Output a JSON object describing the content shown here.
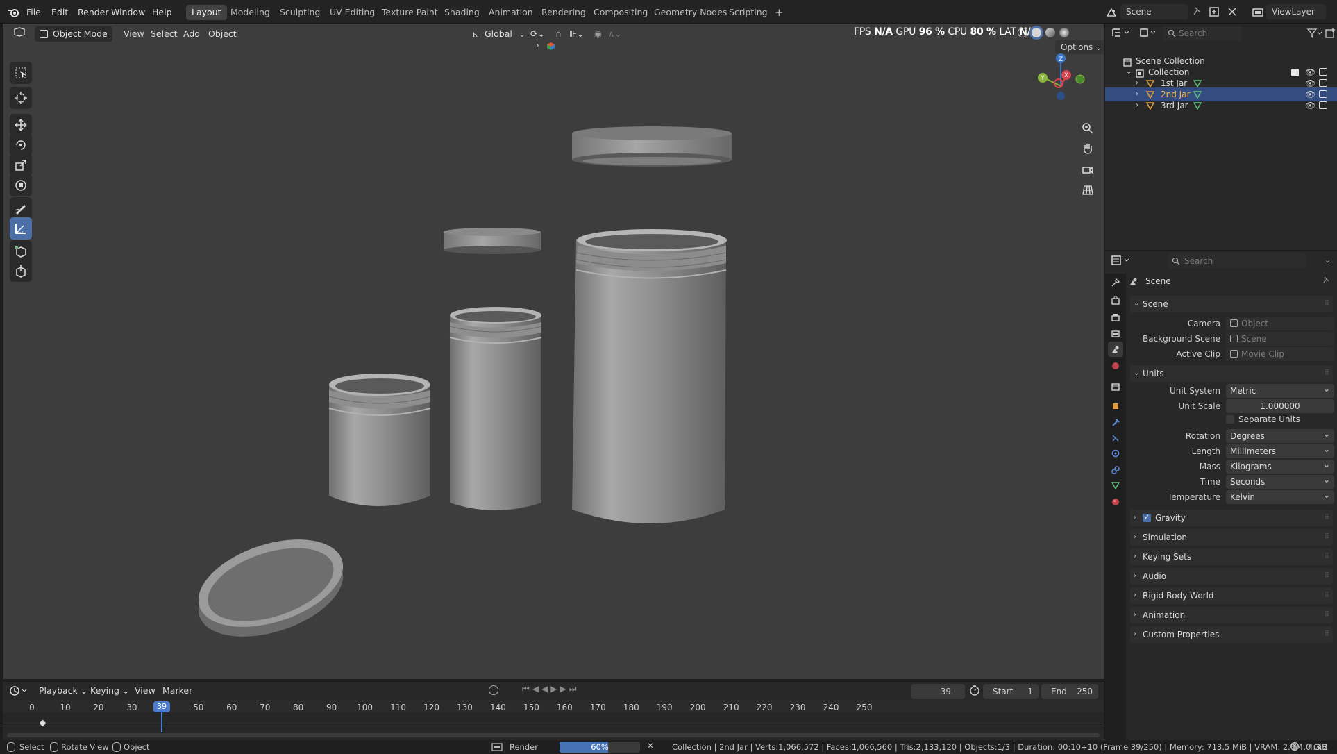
{
  "menu": {
    "file": "File",
    "edit": "Edit",
    "render": "Render",
    "window": "Window",
    "help": "Help"
  },
  "workspaces": [
    "Layout",
    "Modeling",
    "Sculpting",
    "UV Editing",
    "Texture Paint",
    "Shading",
    "Animation",
    "Rendering",
    "Compositing",
    "Geometry Nodes",
    "Scripting"
  ],
  "active_workspace": "Layout",
  "add_workspace": "+",
  "scene_field": "Scene",
  "viewlayer_field": "ViewLayer",
  "overlay_stats": {
    "fps_label": "FPS",
    "fps_value": "N/A",
    "gpu_label": "GPU",
    "gpu_value": "96 %",
    "cpu_label": "CPU",
    "cpu_value": "80 %",
    "lat_label": "LAT",
    "lat_value": "N/A"
  },
  "viewport": {
    "mode": "Object Mode",
    "menus": [
      "View",
      "Select",
      "Add",
      "Object"
    ],
    "orientation": "Global",
    "options": "Options",
    "gizmo_axes": {
      "x": "X",
      "y": "Y",
      "z": "Z"
    }
  },
  "outliner": {
    "search_placeholder": "Search",
    "scene_collection": "Scene Collection",
    "collection": "Collection",
    "objects": [
      {
        "name": "1st Jar",
        "selected": false
      },
      {
        "name": "2nd Jar",
        "selected": true
      },
      {
        "name": "3rd Jar",
        "selected": false
      }
    ]
  },
  "properties": {
    "search_placeholder": "Search",
    "context_title": "Scene",
    "scene_panel": {
      "title": "Scene",
      "camera_label": "Camera",
      "camera_placeholder": "Object",
      "background_label": "Background Scene",
      "background_placeholder": "Scene",
      "clip_label": "Active Clip",
      "clip_placeholder": "Movie Clip"
    },
    "units_panel": {
      "title": "Units",
      "unit_system_label": "Unit System",
      "unit_system": "Metric",
      "unit_scale_label": "Unit Scale",
      "unit_scale": "1.000000",
      "separate_units": "Separate Units",
      "rotation_label": "Rotation",
      "rotation": "Degrees",
      "length_label": "Length",
      "length": "Millimeters",
      "mass_label": "Mass",
      "mass": "Kilograms",
      "time_label": "Time",
      "time": "Seconds",
      "temperature_label": "Temperature",
      "temperature": "Kelvin"
    },
    "collapsed_panels": [
      "Gravity",
      "Simulation",
      "Keying Sets",
      "Audio",
      "Rigid Body World",
      "Animation",
      "Custom Properties"
    ],
    "gravity_checked": true
  },
  "timeline": {
    "menus": [
      "Playback",
      "Keying",
      "View",
      "Marker"
    ],
    "current_frame": "39",
    "start_label": "Start",
    "start": "1",
    "end_label": "End",
    "end": "250",
    "ticks": [
      0,
      10,
      20,
      30,
      50,
      60,
      70,
      80,
      90,
      100,
      110,
      120,
      130,
      140,
      150,
      160,
      170,
      180,
      190,
      200,
      210,
      220,
      230,
      240,
      250
    ]
  },
  "statusbar": {
    "select": "Select",
    "rotate_view": "Rotate View",
    "object": "Object",
    "render_label": "Render",
    "render_progress": "60%",
    "render_fraction": 0.6,
    "stats": "Collection | 2nd Jar | Verts:1,066,572 | Faces:1,066,560 | Tris:2,133,120 | Objects:1/3 | Duration: 00:10+10 (Frame 39/250) | Memory: 713.5 MiB | VRAM: 2.0/4.0 GiB",
    "version": "4.3.2"
  },
  "colors": {
    "accent": "#4d6fa7",
    "selection": "#334d80",
    "viewport_bg": "#3d3d3d",
    "object_orange": "#e09a3c",
    "mesh_green": "#5ec07a"
  }
}
